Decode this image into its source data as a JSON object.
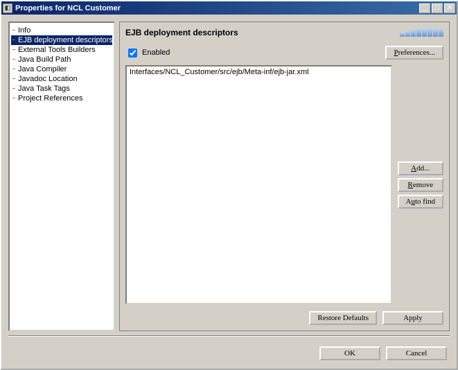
{
  "window": {
    "title": "Properties for NCL Customer"
  },
  "tree": {
    "items": [
      {
        "label": "Info",
        "selected": false
      },
      {
        "label": "EJB deployment descriptors",
        "selected": true
      },
      {
        "label": "External Tools Builders",
        "selected": false
      },
      {
        "label": "Java Build Path",
        "selected": false
      },
      {
        "label": "Java Compiler",
        "selected": false
      },
      {
        "label": "Javadoc Location",
        "selected": false
      },
      {
        "label": "Java Task Tags",
        "selected": false
      },
      {
        "label": "Project References",
        "selected": false
      }
    ]
  },
  "panel": {
    "title": "EJB deployment descriptors",
    "enabled_label": "Enabled",
    "enabled_checked": true,
    "preferences_label": "Preferences...",
    "list": [
      "Interfaces/NCL_Customer/src/ejb/Meta-inf/ejb-jar.xml"
    ],
    "add_label": "Add...",
    "remove_label": "Remove",
    "autofind_label": "Auto find",
    "restore_label": "Restore Defaults",
    "apply_label": "Apply"
  },
  "dialog": {
    "ok_label": "OK",
    "cancel_label": "Cancel"
  }
}
